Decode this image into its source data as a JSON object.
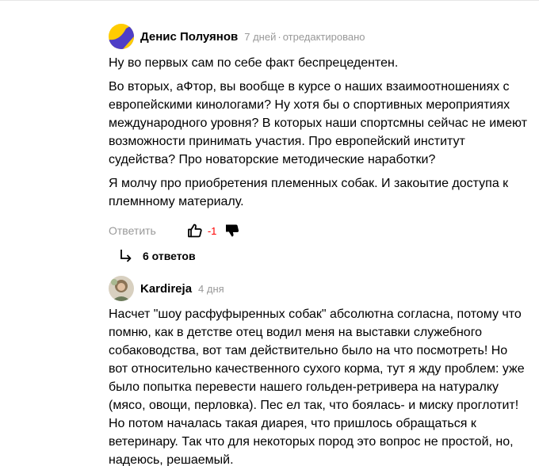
{
  "comments": [
    {
      "author": "Денис Полуянов",
      "time": "7 дней",
      "edited": "отредактировано",
      "paragraphs": [
        "Ну во первых сам по себе факт беспрецедентен.",
        "Во вторых, аФтор, вы вообще в курсе о наших взаимоотношениях с европейскими кинологами? Ну хотя бы о спортивных мероприятиях международного уровня? В которых наши спортсмны сейчас не имеют возможности принимать участия. Про европейский институт судейства? Про новаторские методические наработки?",
        "Я молчу про приобретения племенных собак. И закоытие доступа к племнному материалу."
      ],
      "reply_label": "Ответить",
      "score": "-1",
      "replies_label": "6 ответов"
    },
    {
      "author": "Kardireja",
      "time": "4 дня",
      "paragraphs": [
        "Насчет \"шоу расфуфыренных собак\" абсолютна согласна, потому что помню, как в детстве отец водил меня на выставки служебного собаководства, вот там действительно было на что посмотреть! Но вот относительно качественного сухого корма, тут я жду проблем: уже было попытка перевести нашего гольден-ретривера на натуралку (мясо, овощи, перловка). Пес ел так, что боялась- и миску проглотит! Но потом началась такая диарея, что пришлось обращаться к ветеринару. Так что для некоторых пород это вопрос не простой, но, надеюсь, решаемый."
      ]
    }
  ],
  "icons": [
    "thumbs-up-icon",
    "thumbs-down-icon",
    "reply-arrow-icon"
  ],
  "colors": {
    "score_negative": "#ff0000",
    "meta_gray": "#999999"
  }
}
